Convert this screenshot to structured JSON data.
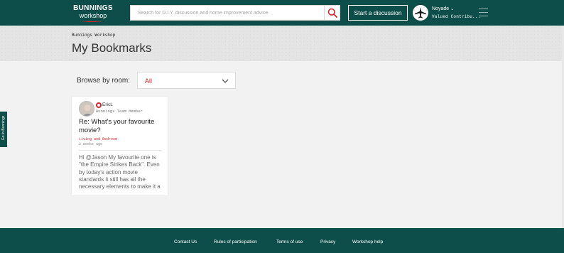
{
  "header": {
    "logo_brand": "BUNNINGS",
    "logo_sub": "workshop",
    "search_placeholder": "Search for D.I.Y. discussion and home improvement advice",
    "start_button": "Start a discussion",
    "user_name": "Noyade",
    "user_rank": "Valued Contribu...",
    "icons": [
      "search-icon",
      "chevron-down-icon",
      "menu-icon"
    ]
  },
  "banner": {
    "breadcrumb": "Bunnings Workshop",
    "title": "My Bookmarks"
  },
  "filter": {
    "label": "Browse by room:",
    "selected": "All"
  },
  "post": {
    "author": "EricL",
    "author_role": "Bunnings Team Member",
    "title": "Re: What's your favourite movie?",
    "room": "Living and Bedroom",
    "time": "2 weeks ago",
    "excerpt": "Hi @Jason My favourite one is \"the Empire Strikes Back\". Even by today's action movie standards it still has all the necessary elements to make it a"
  },
  "side_tab": "Go to Bunnings",
  "footer": {
    "links": [
      "Contact Us",
      "Rules of participation",
      "Terms of use",
      "Privacy",
      "Workshop help"
    ]
  },
  "colors": {
    "brand_green": "#0e4e4a",
    "accent_red": "#d3262b",
    "background": "#f2f2f2"
  }
}
